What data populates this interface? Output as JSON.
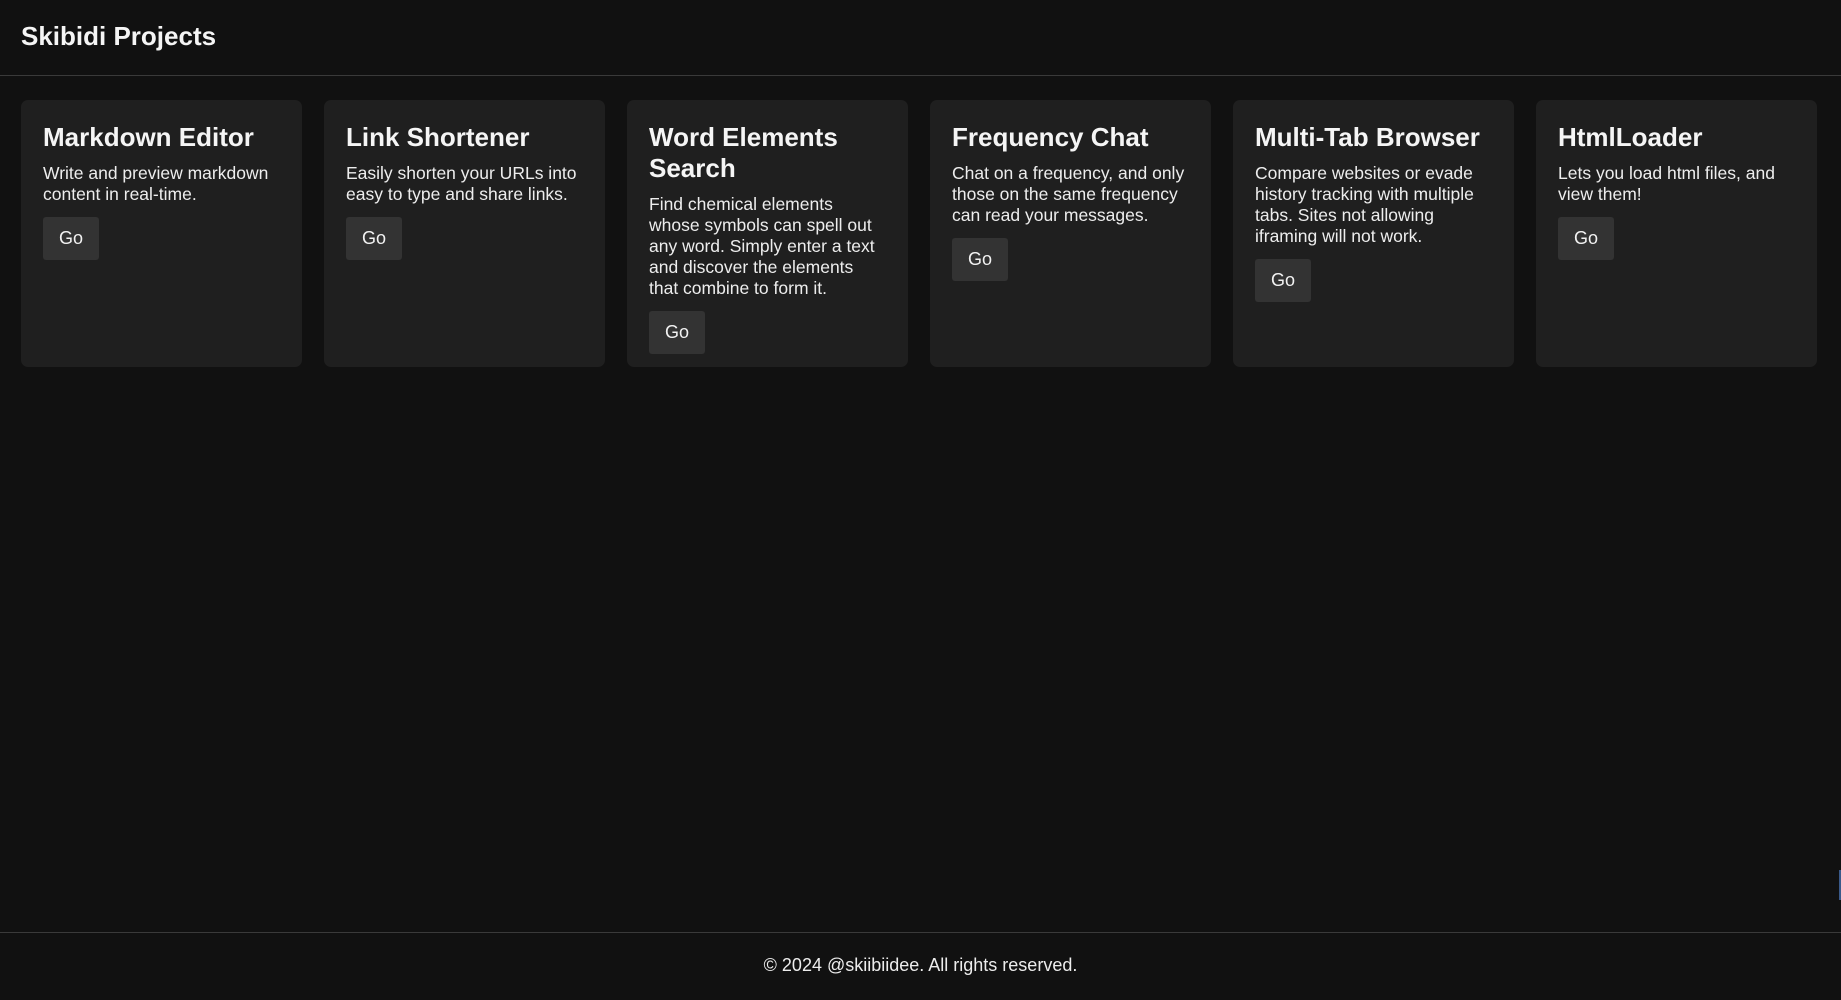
{
  "header": {
    "title": "Skibidi Projects"
  },
  "cards": [
    {
      "title": "Markdown Editor",
      "description": "Write and preview markdown content in real-time.",
      "button_label": "Go"
    },
    {
      "title": "Link Shortener",
      "description": "Easily shorten your URLs into easy to type and share links.",
      "button_label": "Go"
    },
    {
      "title": "Word Elements Search",
      "description": "Find chemical elements whose symbols can spell out any word. Simply enter a text and discover the elements that combine to form it.",
      "button_label": "Go"
    },
    {
      "title": "Frequency Chat",
      "description": "Chat on a frequency, and only those on the same frequency can read your messages.",
      "button_label": "Go"
    },
    {
      "title": "Multi-Tab Browser",
      "description": "Compare websites or evade history tracking with multiple tabs. Sites not allowing iframing will not work.",
      "button_label": "Go"
    },
    {
      "title": "HtmlLoader",
      "description": "Lets you load html files, and view them!",
      "button_label": "Go"
    }
  ],
  "footer": {
    "text": "© 2024 @skiibiidee. All rights reserved."
  }
}
